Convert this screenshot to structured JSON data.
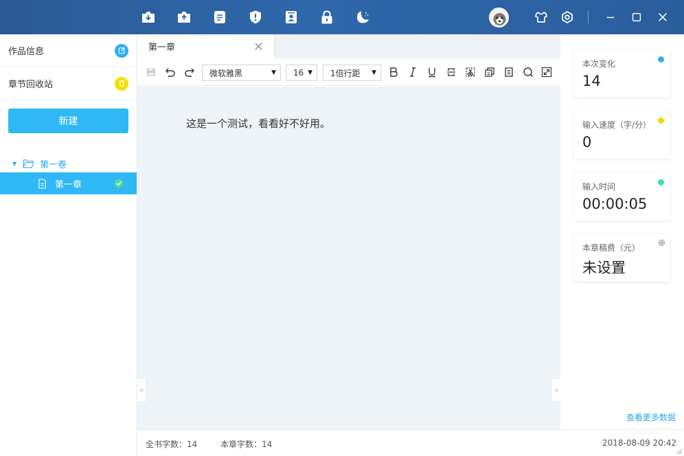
{
  "colors": {
    "accent": "#2fb8f5",
    "titlebar": "#2e68ab",
    "dot_change": "#2fb0f0",
    "dot_speed": "#f5d800",
    "dot_time": "#3ee0a8",
    "recycle_icon": "#f5e000"
  },
  "titlebar": {
    "icons": [
      "download-icon",
      "upload-icon",
      "document-icon",
      "shield-icon",
      "contacts-icon",
      "lock-icon",
      "night-mode-icon"
    ],
    "window_buttons": [
      "shirt-icon",
      "settings-icon",
      "minimize-icon",
      "maximize-icon",
      "close-icon"
    ]
  },
  "sidebar": {
    "work_info": "作品信息",
    "recycle_bin": "章节回收站",
    "new_button": "新建",
    "volume": "第一卷",
    "chapter": "第一章"
  },
  "tabs": [
    {
      "label": "第一章"
    }
  ],
  "toolbar": {
    "font_family": "微软雅黑",
    "font_size": "16",
    "line_spacing": "1倍行距"
  },
  "editor": {
    "content": "这是一个测试，看看好不好用。"
  },
  "statusbar": {
    "book_words": "全书字数：14",
    "chapter_words": "本章字数：14",
    "datetime": "2018-08-09 20:42"
  },
  "stats": {
    "change_label": "本次变化",
    "change_value": "14",
    "speed_label": "输入速度（字/分）",
    "speed_value": "0",
    "time_label": "输入时间",
    "time_value": "00:00:05",
    "fee_label": "本章稿费（元）",
    "fee_value": "未设置",
    "more_link": "查看更多数据"
  }
}
